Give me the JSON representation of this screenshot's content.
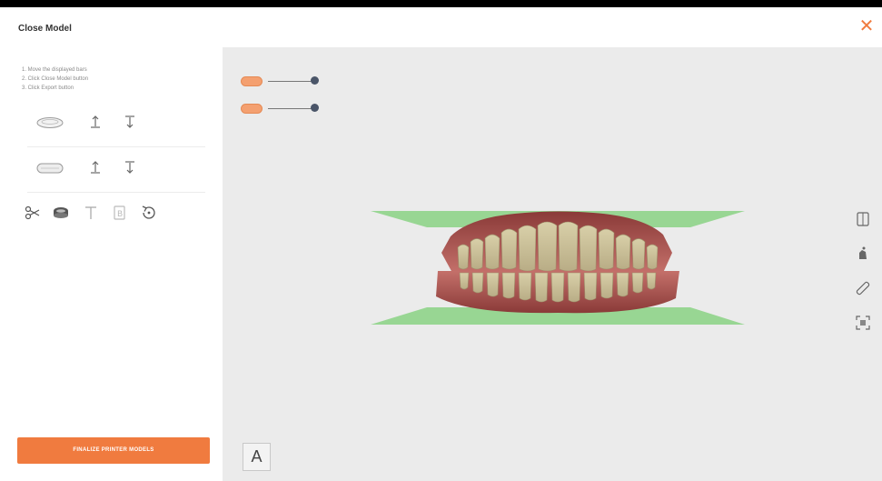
{
  "window": {
    "title": "Close Model",
    "close_icon": "close-icon",
    "accent_color": "#f07b3f"
  },
  "sidebar": {
    "steps": [
      "1. Move the displayed bars",
      "2. Click Close Model button",
      "3. Click Export button"
    ],
    "model_rows": [
      {
        "name": "upper-jaw",
        "icon": "upper-jaw-icon"
      },
      {
        "name": "lower-jaw",
        "icon": "lower-jaw-icon"
      }
    ],
    "tools": [
      "scissors-icon",
      "jaw-base-icon",
      "text-tool-icon",
      "bold-tool-icon",
      "undo-icon"
    ],
    "finalize_label": "FINALIZE PRINTER MODELS"
  },
  "viewport": {
    "background": "#ebebeb",
    "layers": [
      {
        "name": "upper-layer",
        "color": "#f4a070"
      },
      {
        "name": "lower-layer",
        "color": "#f4a070"
      }
    ],
    "plane_color": "#8fd48a",
    "right_tools": [
      "fit-view-icon",
      "paint-icon",
      "ruler-icon",
      "frame-icon"
    ],
    "font_button_label": "A"
  }
}
